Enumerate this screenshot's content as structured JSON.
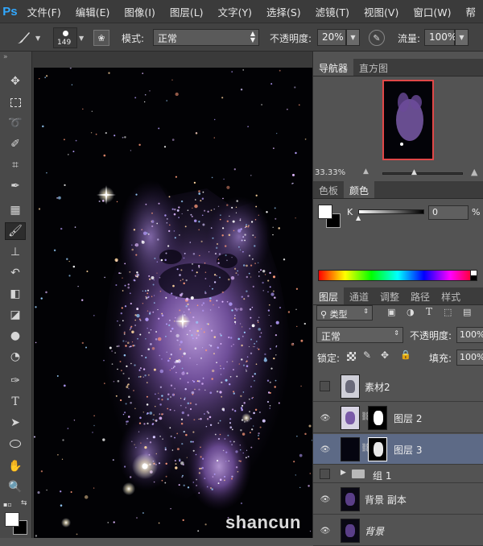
{
  "app": {
    "logo": "Ps"
  },
  "menu": [
    "文件(F)",
    "编辑(E)",
    "图像(I)",
    "图层(L)",
    "文字(Y)",
    "选择(S)",
    "滤镜(T)",
    "视图(V)",
    "窗口(W)",
    "帮"
  ],
  "options": {
    "brush_size": "149",
    "mode_label": "模式:",
    "mode_value": "正常",
    "opacity_label": "不透明度:",
    "opacity_value": "20%",
    "flow_label": "流量:",
    "flow_value": "100%"
  },
  "tools": [
    "move-tool-icon",
    "marquee-tool-icon",
    "lasso-tool-icon",
    "quick-select-tool-icon",
    "crop-tool-icon",
    "eyedropper-tool-icon",
    "healing-brush-tool-icon",
    "brush-tool-icon",
    "clone-stamp-tool-icon",
    "history-brush-tool-icon",
    "eraser-tool-icon",
    "paint-bucket-tool-icon",
    "blur-tool-icon",
    "dodge-tool-icon",
    "pen-tool-icon",
    "type-tool-icon",
    "path-select-tool-icon",
    "shape-tool-icon",
    "hand-tool-icon",
    "zoom-tool-icon"
  ],
  "navigator": {
    "tabs": [
      "导航器",
      "直方图"
    ],
    "zoom": "33.33%"
  },
  "color_panel": {
    "tabs": [
      "色板",
      "颜色"
    ],
    "channel": "K",
    "value": "0",
    "unit": "%"
  },
  "layers_panel": {
    "tabs": [
      "图层",
      "通道",
      "调整",
      "路径",
      "样式"
    ],
    "filter_label": "类型",
    "blend_mode": "正常",
    "opacity_label": "不透明度:",
    "opacity_value": "100%",
    "lock_label": "锁定:",
    "fill_label": "填充:",
    "fill_value": "100%",
    "layers": [
      {
        "name": "素材2",
        "visible": false
      },
      {
        "name": "图层 2",
        "visible": true
      },
      {
        "name": "图层 3",
        "visible": true,
        "selected": true
      },
      {
        "name": "组 1",
        "visible": false
      },
      {
        "name": "背景 副本",
        "visible": true
      },
      {
        "name": "背景",
        "visible": true
      }
    ]
  },
  "watermark": "shancun"
}
